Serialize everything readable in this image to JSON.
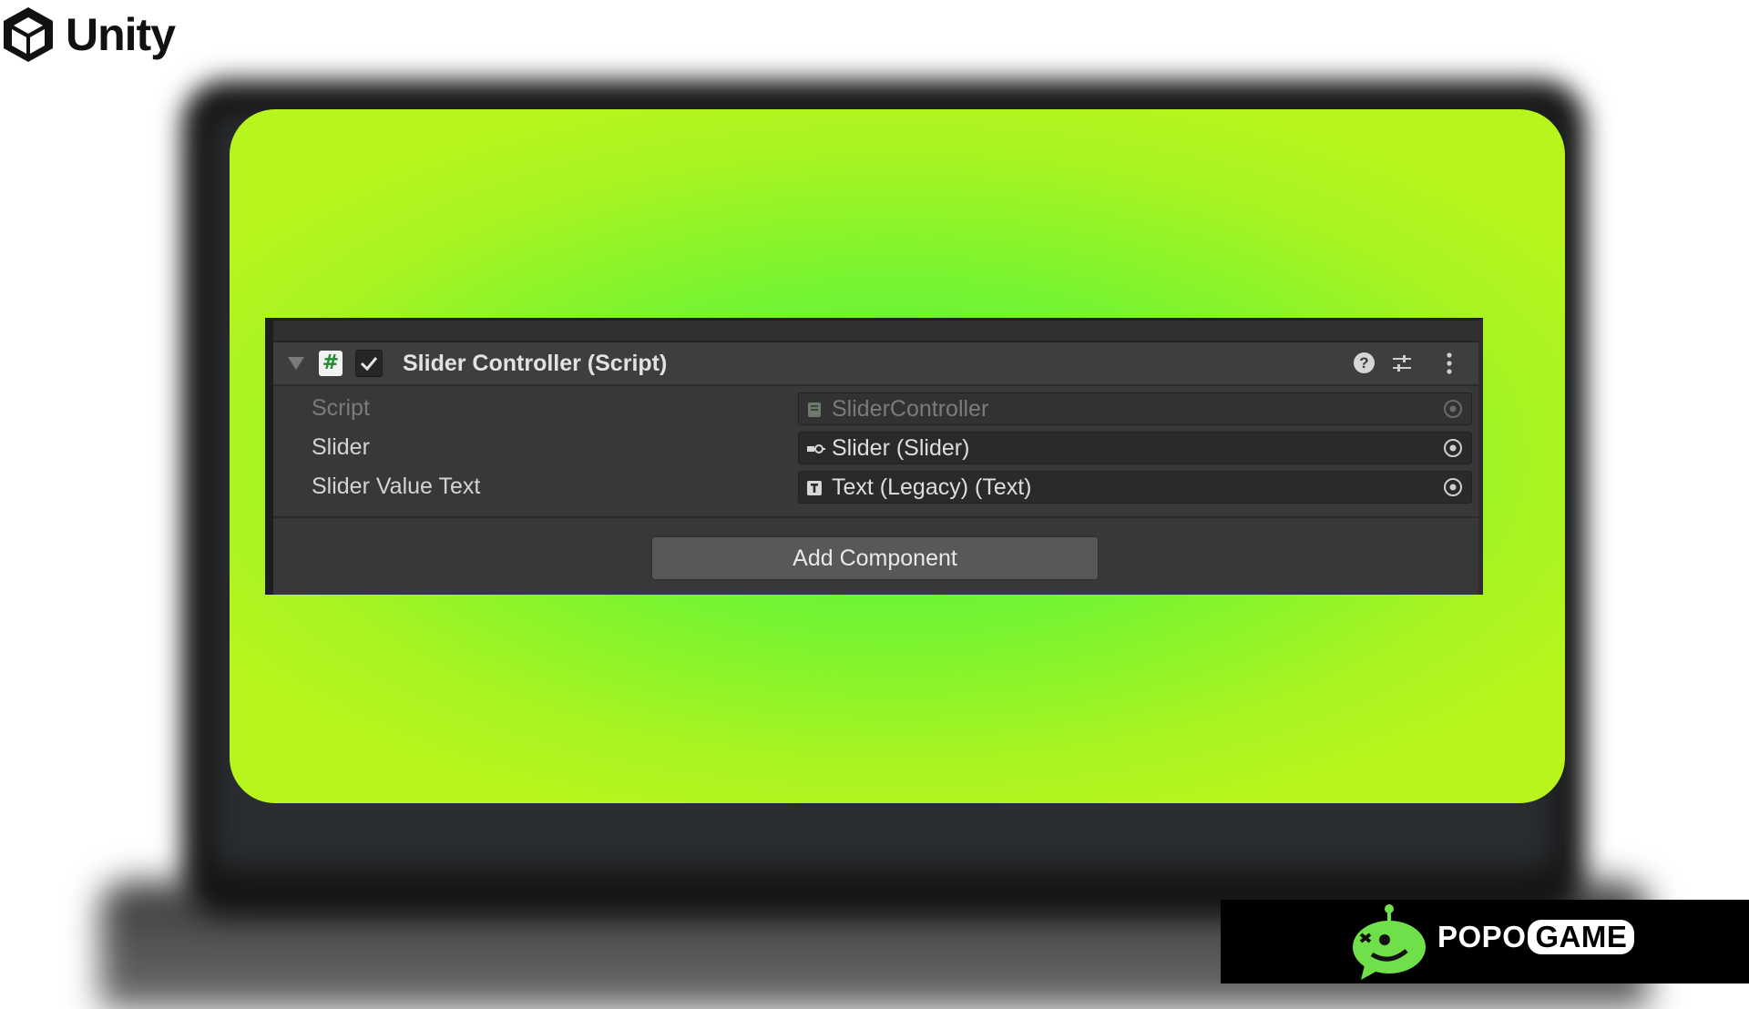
{
  "logo": {
    "text": "Unity"
  },
  "component": {
    "title": "Slider Controller (Script)",
    "enabled": true,
    "icons": {
      "script": "hash-icon",
      "help": "help-icon",
      "presets": "settings-sliders-icon",
      "menu": "more-vertical-icon"
    }
  },
  "fields": [
    {
      "label": "Script",
      "value": "SliderController",
      "icon": "script-asset-icon",
      "disabled": true
    },
    {
      "label": "Slider",
      "value": "Slider (Slider)",
      "icon": "slider-icon",
      "disabled": false
    },
    {
      "label": "Slider Value Text",
      "value": "Text (Legacy) (Text)",
      "icon": "text-component-icon",
      "disabled": false
    }
  ],
  "add_component_label": "Add Component",
  "watermark": {
    "brand": "POPO",
    "brand_suffix": "GAME"
  },
  "colors": {
    "accent_green": "#76f431",
    "panel_bg": "#383838"
  }
}
